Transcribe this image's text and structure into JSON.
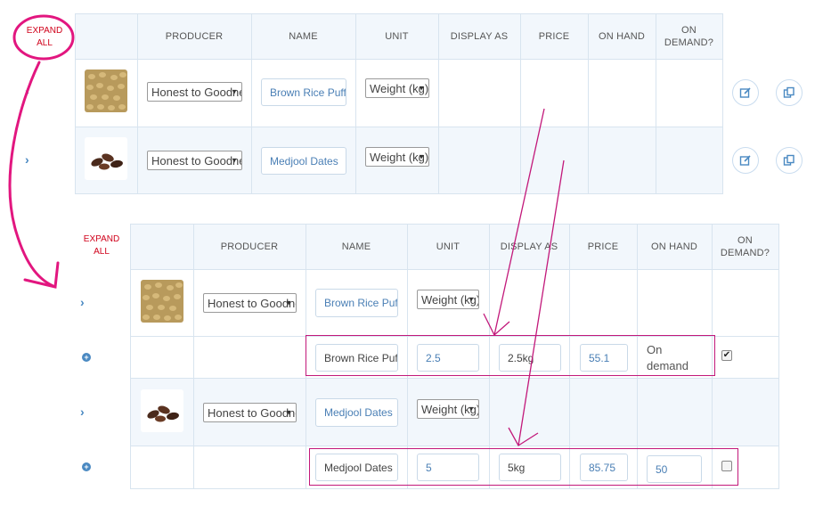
{
  "annotation": {
    "expand_all_line1": "EXPAND",
    "expand_all_line2": "ALL"
  },
  "table": {
    "columns": {
      "producer": "PRODUCER",
      "name": "NAME",
      "unit": "UNIT",
      "display_as": "DISPLAY AS",
      "price": "PRICE",
      "on_hand": "ON HAND",
      "on_demand_line1": "ON",
      "on_demand_line2": "DEMAND?"
    },
    "expand_all_line1": "EXPAND",
    "expand_all_line2": "ALL"
  },
  "products": [
    {
      "producer": "Honest to Goodness",
      "name": "Brown Rice Puffs",
      "unit": "Weight (kg)",
      "variant": {
        "name": "Brown Rice Puffs",
        "unit_value": "2.5",
        "display_as": "2.5kg",
        "price": "55.1",
        "on_hand_line1": "On",
        "on_hand_line2": "demand",
        "on_demand_checked": "✔"
      }
    },
    {
      "producer": "Honest to Goodness",
      "name": "Medjool Dates",
      "unit": "Weight (kg)",
      "variant": {
        "name": "Medjool Dates",
        "unit_value": "5",
        "display_as": "5kg",
        "price": "85.75",
        "on_hand": "50",
        "on_demand_checked": ""
      }
    }
  ],
  "icons": {
    "expand_row": "chevron-right-icon",
    "variant_add": "plus-circle-icon",
    "edit": "edit-icon",
    "clone": "clone-icon"
  },
  "colors": {
    "accent": "#4a89c2",
    "annotation": "#c2187a",
    "expand_all_text": "#d0021b"
  }
}
